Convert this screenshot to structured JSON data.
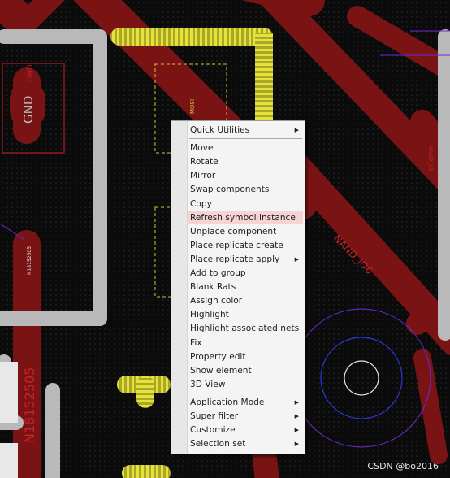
{
  "colors": {
    "trace_red": "#7a1414",
    "trace_gray": "#b9b9b9",
    "trace_yellow": "#c8c020",
    "netname_red": "#c9202a",
    "menu_bg": "#f4f4f4",
    "menu_highlight": "#f7d4d4"
  },
  "board": {
    "labels": {
      "gnd_big": "GND",
      "gnd_small": "GND",
      "mosi": "MOSI",
      "nand_io6": "NAND_IO6",
      "n18152505_small": "N18152505",
      "n18152505_big": "N18152505",
      "right_vertical": "NAND_IO"
    }
  },
  "menu": {
    "groups": [
      {
        "items": [
          {
            "label": "Quick Utilities",
            "submenu": true
          }
        ]
      },
      {
        "items": [
          {
            "label": "Move"
          },
          {
            "label": "Rotate"
          },
          {
            "label": "Mirror"
          },
          {
            "label": "Swap components"
          },
          {
            "label": "Copy"
          },
          {
            "label": "Refresh symbol instance",
            "highlighted": true
          },
          {
            "label": "Unplace component"
          },
          {
            "label": "Place replicate create"
          },
          {
            "label": "Place replicate apply",
            "submenu": true
          },
          {
            "label": "Add to group"
          },
          {
            "label": "Blank Rats"
          },
          {
            "label": "Assign color"
          },
          {
            "label": "Highlight"
          },
          {
            "label": "Highlight associated nets"
          },
          {
            "label": "Fix"
          },
          {
            "label": "Property edit"
          },
          {
            "label": "Show element"
          },
          {
            "label": "3D View"
          }
        ]
      },
      {
        "items": [
          {
            "label": "Application Mode",
            "submenu": true
          },
          {
            "label": "Super filter",
            "submenu": true
          },
          {
            "label": "Customize",
            "submenu": true
          },
          {
            "label": "Selection set",
            "submenu": true
          }
        ]
      }
    ],
    "submenu_glyph": "▶"
  },
  "watermark": "CSDN @bo2016"
}
